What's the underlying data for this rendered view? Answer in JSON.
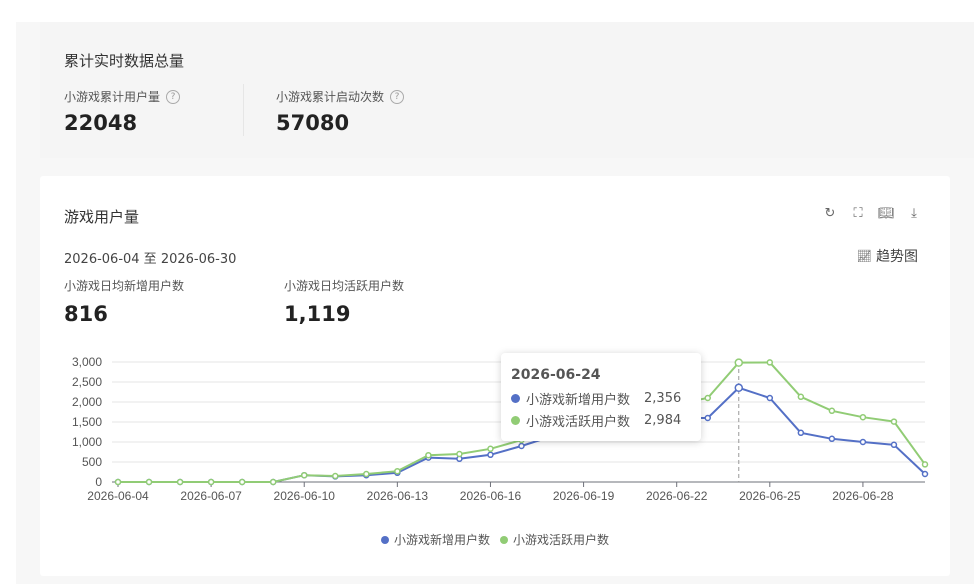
{
  "summary": {
    "title": "累计实时数据总量",
    "metrics": [
      {
        "label": "小游戏累计用户量",
        "value": "22048"
      },
      {
        "label": "小游戏累计启动次数",
        "value": "57080"
      }
    ]
  },
  "card": {
    "title": "游戏用户量",
    "date_range": "2026-06-04 至 2026-06-30",
    "trend_label": "趋势图",
    "kpis": [
      {
        "label": "小游戏日均新增用户数",
        "value": "816"
      },
      {
        "label": "小游戏日均活跃用户数",
        "value": "1,119"
      }
    ],
    "icons": [
      "refresh-icon",
      "fullscreen-icon",
      "book-icon",
      "download-icon"
    ]
  },
  "tooltip": {
    "date": "2026-06-24",
    "rows": [
      {
        "name": "小游戏新增用户数",
        "value": "2,356"
      },
      {
        "name": "小游戏活跃用户数",
        "value": "2,984"
      }
    ]
  },
  "colors": {
    "series1": "#5470c6",
    "series2": "#91cc75"
  },
  "chart_data": {
    "type": "line",
    "x": [
      "2026-06-04",
      "2026-06-05",
      "2026-06-06",
      "2026-06-07",
      "2026-06-08",
      "2026-06-09",
      "2026-06-10",
      "2026-06-11",
      "2026-06-12",
      "2026-06-13",
      "2026-06-14",
      "2026-06-15",
      "2026-06-16",
      "2026-06-17",
      "2026-06-18",
      "2026-06-19",
      "2026-06-20",
      "2026-06-21",
      "2026-06-22",
      "2026-06-23",
      "2026-06-24",
      "2026-06-25",
      "2026-06-26",
      "2026-06-27",
      "2026-06-28",
      "2026-06-29",
      "2026-06-30"
    ],
    "x_tick_labels": [
      "2026-06-04",
      "2026-06-07",
      "2026-06-10",
      "2026-06-13",
      "2026-06-16",
      "2026-06-19",
      "2026-06-22",
      "2026-06-25",
      "2026-06-28"
    ],
    "y_ticks": [
      "0",
      "500",
      "1,000",
      "1,500",
      "2,000",
      "2,500",
      "3,000"
    ],
    "ylim": [
      0,
      3000
    ],
    "series": [
      {
        "name": "小游戏新增用户数",
        "values": [
          0,
          0,
          0,
          0,
          0,
          0,
          170,
          140,
          170,
          230,
          610,
          580,
          680,
          900,
          1150,
          1350,
          1500,
          1600,
          1600,
          1600,
          2356,
          2100,
          1230,
          1080,
          1000,
          930,
          200
        ]
      },
      {
        "name": "小游戏活跃用户数",
        "values": [
          0,
          0,
          0,
          0,
          0,
          0,
          170,
          150,
          200,
          270,
          670,
          700,
          830,
          1050,
          1300,
          1500,
          1700,
          1850,
          1950,
          2100,
          2984,
          2990,
          2130,
          1780,
          1620,
          1510,
          440
        ]
      }
    ],
    "legend": [
      "小游戏新增用户数",
      "小游戏活跃用户数"
    ],
    "legend_position": "bottom",
    "grid": true,
    "highlight_index": 20
  }
}
